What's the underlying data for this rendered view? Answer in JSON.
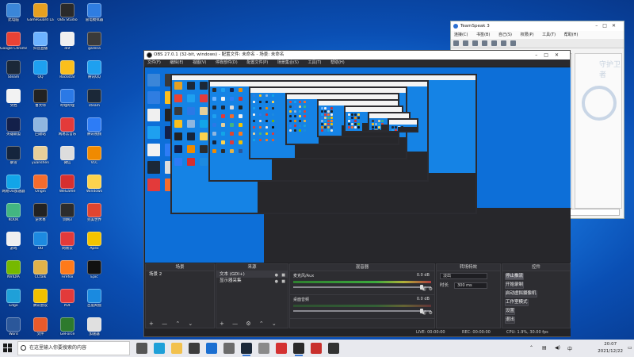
{
  "desktop_icons": [
    {
      "label": "此电脑",
      "color": "#3b86d8"
    },
    {
      "label": "GameGuard Launcher",
      "color": "#e6a020"
    },
    {
      "label": "OBS Studio",
      "color": "#2a2a2a"
    },
    {
      "label": "雷电模拟器",
      "color": "#2f7de1"
    },
    {
      "label": "Google Chrome",
      "color": "#e94235"
    },
    {
      "label": "抖音直播",
      "color": "#6cb2ff"
    },
    {
      "label": "dnf",
      "color": "#f0f0f0"
    },
    {
      "label": "garena",
      "color": "#3a3a3a"
    },
    {
      "label": "Steam",
      "color": "#1b2838"
    },
    {
      "label": "QQ",
      "color": "#1ea0f0"
    },
    {
      "label": "Rockstar",
      "color": "#fbbf1c"
    },
    {
      "label": "腾讯QQ",
      "color": "#1ea0f0"
    },
    {
      "label": "文档",
      "color": "#f2f2f2"
    },
    {
      "label": "鲁大师",
      "color": "#222"
    },
    {
      "label": "哔哩哔哩",
      "color": "#2b79e6"
    },
    {
      "label": "steam",
      "color": "#1b2838"
    },
    {
      "label": "英雄联盟",
      "color": "#13204a"
    },
    {
      "label": "回收站",
      "color": "#8fb6e0"
    },
    {
      "label": "网易云音乐",
      "color": "#e33a3a"
    },
    {
      "label": "腾讯视频",
      "color": "#2d7cf6"
    },
    {
      "label": "暴雪",
      "color": "#15253d"
    },
    {
      "label": "yuanshen",
      "color": "#e6cf9a"
    },
    {
      "label": "微信",
      "color": "#ddd"
    },
    {
      "label": "VLC",
      "color": "#f08a00"
    },
    {
      "label": "网易UU加速器",
      "color": "#12a5e8"
    },
    {
      "label": "Origin",
      "color": "#f56c2d"
    },
    {
      "label": "WeGame",
      "color": "#d62f2f"
    },
    {
      "label": "Windows",
      "color": "#fcd34d"
    },
    {
      "label": "KOOK",
      "color": "#43b581"
    },
    {
      "label": "逆水寒",
      "color": "#222"
    },
    {
      "label": "剑网3",
      "color": "#2c2c2c"
    },
    {
      "label": "完美世界",
      "color": "#e0452f"
    },
    {
      "label": "游戏",
      "color": "#f0f0f0"
    },
    {
      "label": "UU",
      "color": "#1d8ae0"
    },
    {
      "label": "网易云",
      "color": "#e23a3a"
    },
    {
      "label": "Apex",
      "color": "#f4c400"
    },
    {
      "label": "NVIDIA",
      "color": "#76b900"
    },
    {
      "label": "CCtalk",
      "color": "#e0b24a"
    },
    {
      "label": "Firefox",
      "color": "#ff7a1a"
    },
    {
      "label": "Epic",
      "color": "#111"
    },
    {
      "label": "Edge",
      "color": "#1fa0d8"
    },
    {
      "label": "腾讯会议",
      "color": "#f0c000"
    },
    {
      "label": "PDF",
      "color": "#e23a3a"
    },
    {
      "label": "百度网盘",
      "color": "#1a8ae0"
    },
    {
      "label": "Word",
      "color": "#2b579a"
    },
    {
      "label": "文件",
      "color": "#e85a2a"
    },
    {
      "label": "GeForce",
      "color": "#2d7a2d"
    },
    {
      "label": "加速器",
      "color": "#e0e0e0"
    }
  ],
  "teamspeak": {
    "title": "TeamSpeak 3",
    "menu": [
      "连接(C)",
      "书签(B)",
      "自己(S)",
      "权限(P)",
      "工具(T)",
      "帮助(H)"
    ],
    "side_text": "守护卫者"
  },
  "obs": {
    "title": "OBS 27.0.1 (32-bit, windows) - 配置文件: 未命名 - 场景: 未命名",
    "menu": [
      "文件(F)",
      "编辑(E)",
      "视图(V)",
      "停靠部件(D)",
      "配置文件(P)",
      "场景集合(S)",
      "工具(T)",
      "帮助(H)"
    ],
    "scenes": {
      "header": "场景",
      "items": [
        "场景 2"
      ]
    },
    "sources": {
      "header": "来源",
      "items": [
        "文本 (GDI+)",
        "显示器采集"
      ]
    },
    "mixer": {
      "header": "混音器",
      "channels": [
        {
          "name": "麦克风/Aux",
          "db": "0.0 dB"
        },
        {
          "name": "桌面音频",
          "db": "0.0 dB"
        }
      ]
    },
    "transitions": {
      "header": "转场特效",
      "type": "淡出",
      "duration_label": "时长",
      "duration_value": "300 ms"
    },
    "controls": {
      "header": "控件",
      "buttons": [
        "停止推流",
        "开始录制",
        "启动虚拟摄像机",
        "工作室模式",
        "设置",
        "退出"
      ]
    },
    "status": {
      "live": "LIVE: 00:00:00",
      "rec": "REC: 00:00:00",
      "cpu": "CPU: 1.9%, 30.00 fps"
    }
  },
  "taskbar": {
    "search_placeholder": "在这里输入你要搜索的内容",
    "apps": [
      {
        "name": "task-view",
        "color": "#555"
      },
      {
        "name": "edge",
        "color": "#1fa0d8"
      },
      {
        "name": "explorer",
        "color": "#f2c14e"
      },
      {
        "name": "store",
        "color": "#3c3c3c"
      },
      {
        "name": "mail",
        "color": "#1b6fd1"
      },
      {
        "name": "app6",
        "color": "#6b6b6b"
      },
      {
        "name": "steam",
        "color": "#1b2838"
      },
      {
        "name": "app8",
        "color": "#8a8a8a"
      },
      {
        "name": "app9",
        "color": "#d43232"
      },
      {
        "name": "obs",
        "color": "#2a2a2a"
      },
      {
        "name": "app11",
        "color": "#c9302c"
      },
      {
        "name": "app12",
        "color": "#333"
      }
    ],
    "time": "20:07",
    "date": "2021/12/22"
  }
}
